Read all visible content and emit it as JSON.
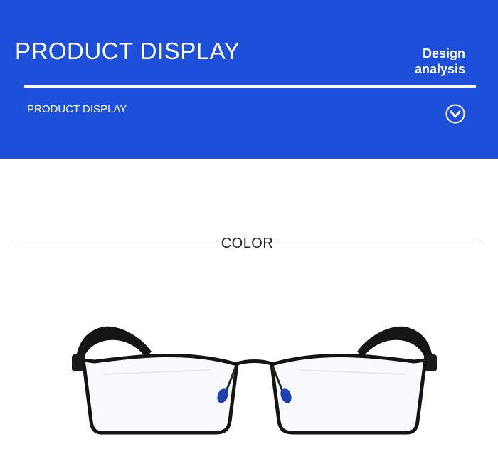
{
  "banner": {
    "title": "PRODUCT DISPLAY",
    "side_line1": "Design",
    "side_line2": "analysis",
    "subtitle": "PRODUCT DISPLAY",
    "chevron_icon": "chevron-down-circle-icon",
    "background_color": "#1d4fd8",
    "text_color": "#ffffff"
  },
  "section": {
    "label": "COLOR"
  },
  "product": {
    "image": "black-rectangular-eyeglasses",
    "frame_color": "#141414",
    "nose_pad_color": "#1e3fae"
  }
}
